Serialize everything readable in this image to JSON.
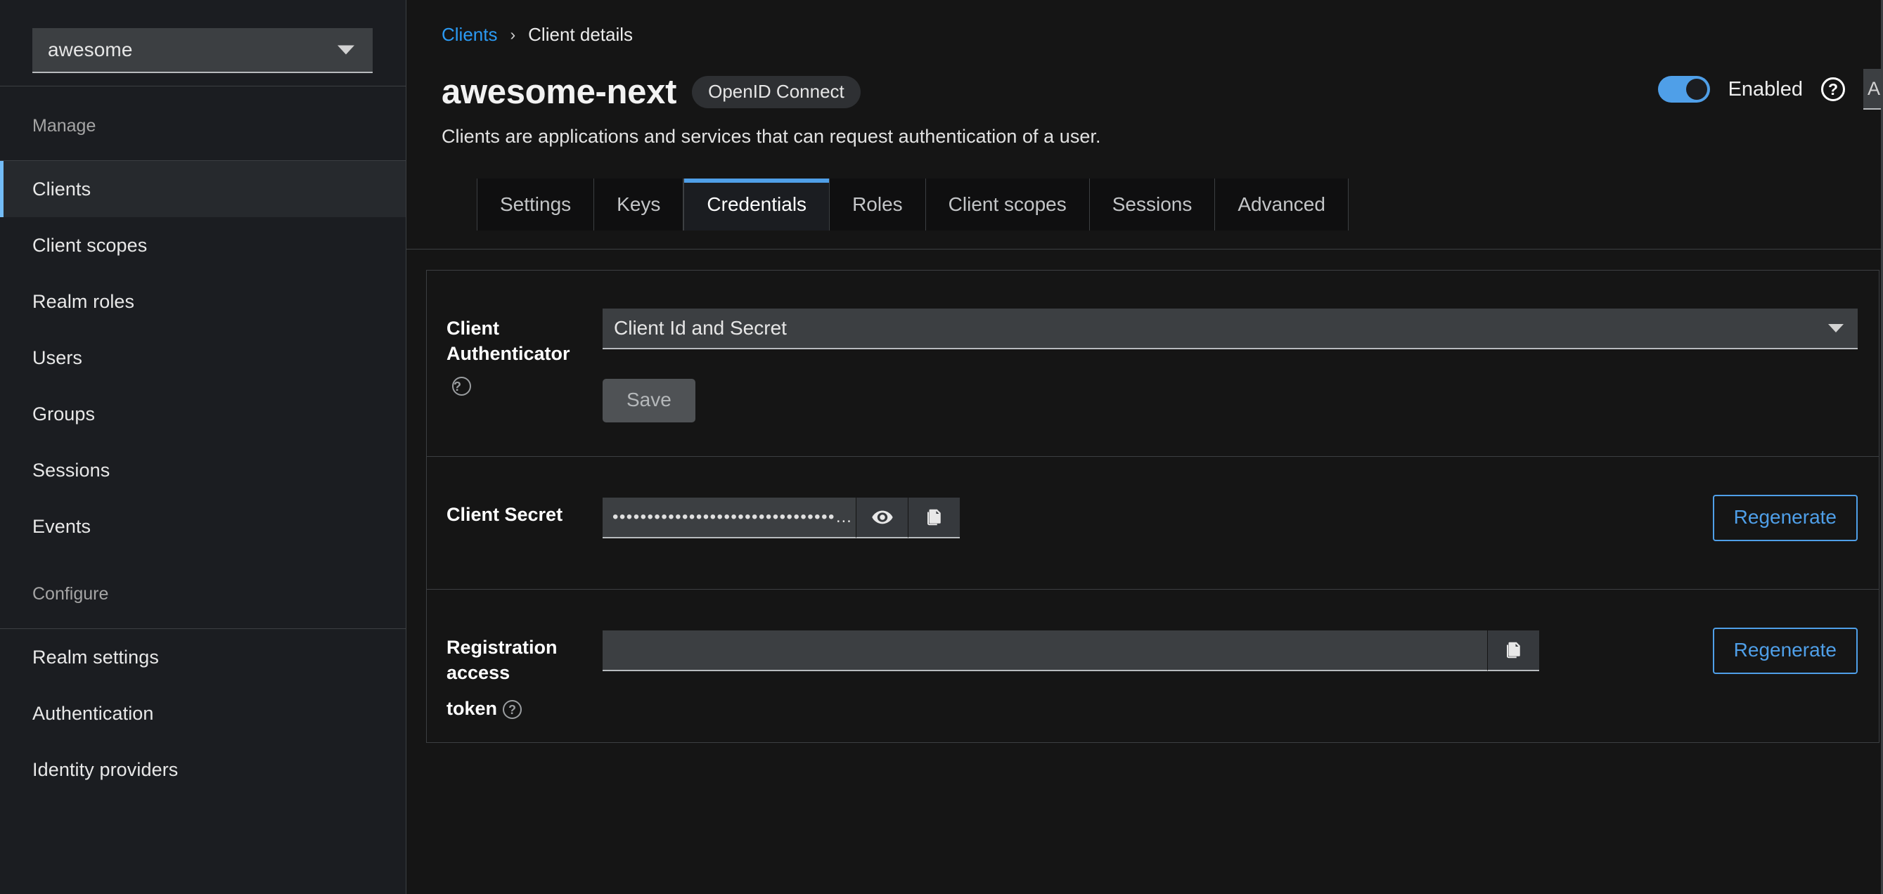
{
  "sidebar": {
    "realm": {
      "name": "awesome",
      "caret_icon": "chevron-down-icon"
    },
    "groups": [
      {
        "title": "Manage",
        "items": [
          {
            "label": "Clients",
            "active": true
          },
          {
            "label": "Client scopes",
            "active": false
          },
          {
            "label": "Realm roles",
            "active": false
          },
          {
            "label": "Users",
            "active": false
          },
          {
            "label": "Groups",
            "active": false
          },
          {
            "label": "Sessions",
            "active": false
          },
          {
            "label": "Events",
            "active": false
          }
        ]
      },
      {
        "title": "Configure",
        "items": [
          {
            "label": "Realm settings",
            "active": false
          },
          {
            "label": "Authentication",
            "active": false
          },
          {
            "label": "Identity providers",
            "active": false
          }
        ]
      }
    ]
  },
  "header": {
    "breadcrumb": {
      "parent": "Clients",
      "separator": "›",
      "current": "Client details"
    },
    "client_name": "awesome-next",
    "protocol_badge": "OpenID Connect",
    "subtitle": "Clients are applications and services that can request authentication of a user.",
    "enabled_toggle": {
      "label": "Enabled",
      "state": "on",
      "accent_color": "#4f9fe8"
    },
    "help_icon": "question-circle-icon",
    "edge_field_value": "A"
  },
  "tabs": [
    {
      "label": "Settings",
      "active": false
    },
    {
      "label": "Keys",
      "active": false
    },
    {
      "label": "Credentials",
      "active": true
    },
    {
      "label": "Roles",
      "active": false
    },
    {
      "label": "Client scopes",
      "active": false
    },
    {
      "label": "Sessions",
      "active": false
    },
    {
      "label": "Advanced",
      "active": false
    }
  ],
  "form": {
    "client_authenticator": {
      "label": "Client Authenticator",
      "help_icon": "question-circle-icon",
      "selected_value": "Client Id and Secret",
      "caret_icon": "chevron-down-icon"
    },
    "save_button": {
      "label": "Save",
      "disabled": true
    },
    "client_secret": {
      "label": "Client Secret",
      "masked_value": "••••••••••••••••••••••••••••••••…",
      "show_icon": "eye-icon",
      "copy_icon": "copy-icon",
      "regenerate_label": "Regenerate"
    },
    "registration_access_token": {
      "label_line1": "Registration access",
      "label_line2": "token",
      "help_icon": "question-circle-icon",
      "value": "",
      "copy_icon": "copy-icon",
      "regenerate_label": "Regenerate"
    }
  },
  "colors": {
    "accent_blue": "#4f9fe8",
    "link_blue": "#2b9af3",
    "sidebar_bg": "#1b1d21",
    "page_bg": "#151515",
    "border": "#3c3f42"
  }
}
